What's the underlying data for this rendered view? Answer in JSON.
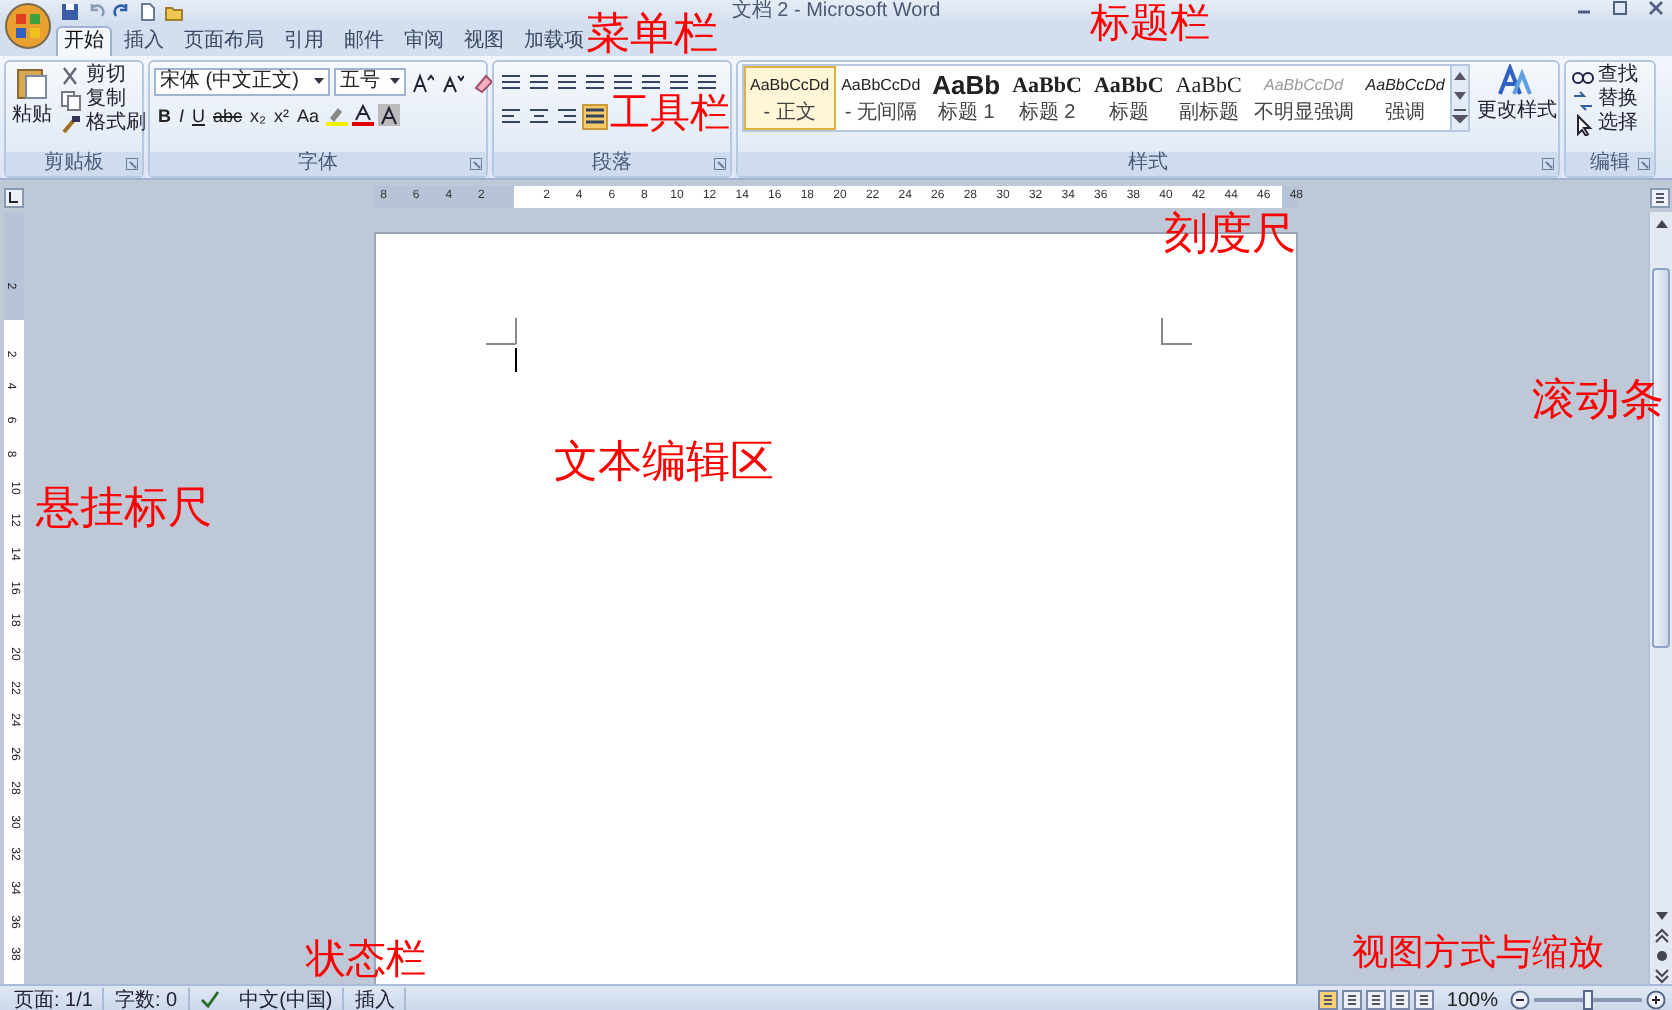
{
  "title_bar": {
    "title": "文档 2 - Microsoft Word"
  },
  "tabs": [
    {
      "label": "开始",
      "selected": true
    },
    {
      "label": "插入",
      "selected": false
    },
    {
      "label": "页面布局",
      "selected": false
    },
    {
      "label": "引用",
      "selected": false
    },
    {
      "label": "邮件",
      "selected": false
    },
    {
      "label": "审阅",
      "selected": false
    },
    {
      "label": "视图",
      "selected": false
    },
    {
      "label": "加载项",
      "selected": false
    }
  ],
  "ribbon": {
    "clipboard": {
      "paste": "粘贴",
      "items": [
        "剪切",
        "复制",
        "格式刷"
      ],
      "title": "剪贴板"
    },
    "font": {
      "font_name": "宋体 (中文正文)",
      "font_size": "五号",
      "format_buttons": [
        "B",
        "I",
        "U",
        "abc",
        "x₂",
        "x²",
        "Aa"
      ],
      "title": "字体"
    },
    "paragraph": {
      "alignments": [
        {
          "kind": "left",
          "selected": false
        },
        {
          "kind": "center",
          "selected": false
        },
        {
          "kind": "right",
          "selected": false
        },
        {
          "kind": "justify",
          "selected": true
        }
      ],
      "title": "段落"
    },
    "styles": {
      "items": [
        {
          "preview": "AaBbCcDd",
          "name": "- 正文",
          "kind": "normal",
          "selected": true
        },
        {
          "preview": "AaBbCcDd",
          "name": "- 无间隔",
          "kind": "normal",
          "selected": false
        },
        {
          "preview": "AaBb",
          "name": "标题 1",
          "kind": "heading1",
          "selected": false
        },
        {
          "preview": "AaBbC",
          "name": "标题 2",
          "kind": "heading2",
          "selected": false
        },
        {
          "preview": "AaBbC",
          "name": "标题",
          "kind": "title",
          "selected": false
        },
        {
          "preview": "AaBbC",
          "name": "副标题",
          "kind": "subtitle",
          "selected": false
        },
        {
          "preview": "AaBbCcDd",
          "name": "不明显强调",
          "kind": "subtle",
          "selected": false
        },
        {
          "preview": "AaBbCcDd",
          "name": "强调",
          "kind": "emphasis",
          "selected": false
        }
      ],
      "change_styles": "更改样式",
      "title": "样式"
    },
    "editing": {
      "items": [
        "查找",
        "替换",
        "选择"
      ],
      "title": "编辑"
    }
  },
  "ruler": {
    "left_labels": [
      "8",
      "6",
      "4",
      "2"
    ],
    "right_labels": [
      "2",
      "4",
      "6",
      "8",
      "10",
      "12",
      "14",
      "16",
      "18",
      "20",
      "22",
      "24",
      "26",
      "28",
      "30",
      "32",
      "34",
      "36",
      "38",
      "40",
      "42",
      "44",
      "46",
      "48"
    ]
  },
  "vertical_ruler": {
    "top_labels": [
      "2"
    ],
    "labels": [
      "2",
      "4",
      "6",
      "8",
      "10",
      "12",
      "14",
      "16",
      "18",
      "20",
      "22",
      "24",
      "26",
      "28",
      "30",
      "32",
      "34",
      "36",
      "38"
    ]
  },
  "status_bar": {
    "items": [
      "页面: 1/1",
      "字数: 0",
      "中文(中国)",
      "插入"
    ],
    "zoom": "100%",
    "level": 0.5
  },
  "annotations": [
    "菜单栏",
    "标题栏",
    "工具栏",
    "刻度尺",
    "滚动条",
    "文本编辑区",
    "悬挂标尺",
    "状态栏",
    "视图方式与缩放"
  ]
}
